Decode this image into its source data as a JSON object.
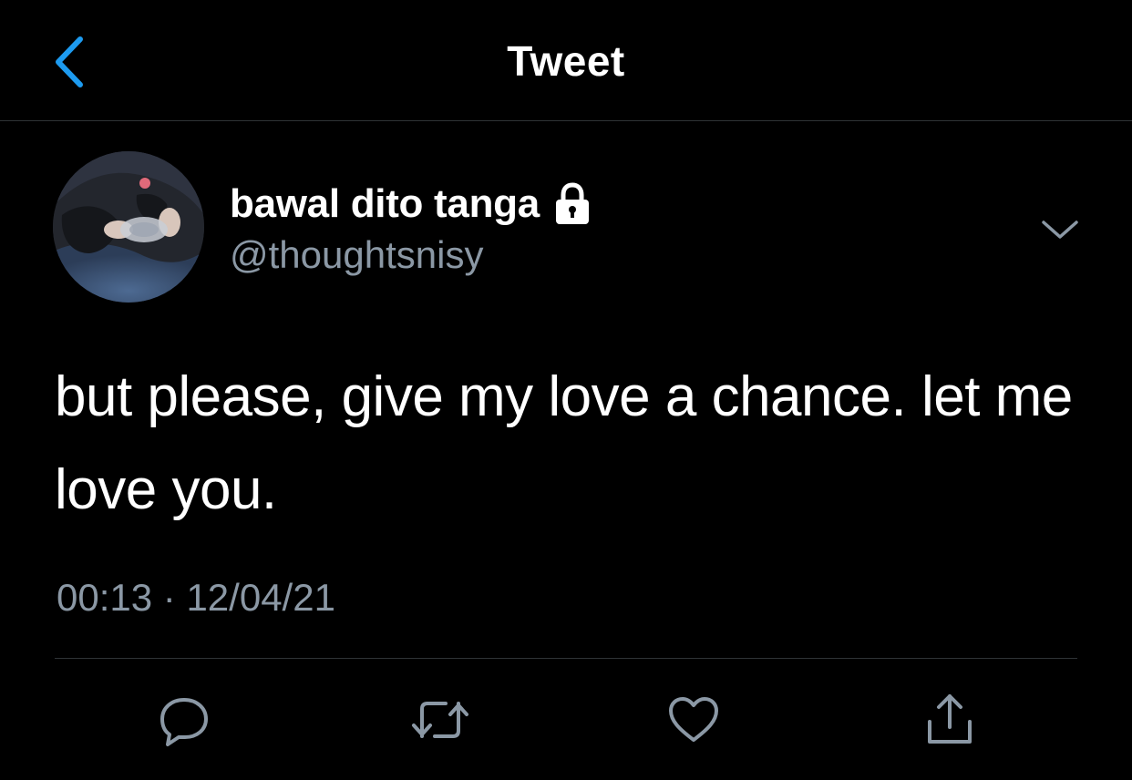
{
  "header": {
    "title": "Tweet",
    "back_icon": "chevron-left-icon",
    "accent_color": "#1d9bf0"
  },
  "author": {
    "display_name": "bawal dito tanga",
    "handle": "@thoughtsnisy",
    "protected_icon": "lock-icon",
    "avatar": "profile-photo"
  },
  "tweet": {
    "text": "but please, give my love a chance. let me love you.",
    "time": "00:13",
    "separator": "·",
    "date": "12/04/21"
  },
  "actions": [
    {
      "name": "reply",
      "icon": "reply-icon"
    },
    {
      "name": "retweet",
      "icon": "retweet-icon"
    },
    {
      "name": "like",
      "icon": "heart-icon"
    },
    {
      "name": "share",
      "icon": "share-icon"
    }
  ],
  "colors": {
    "background": "#000000",
    "text": "#ffffff",
    "secondary_text": "#8b98a5",
    "divider": "#2f3336"
  }
}
